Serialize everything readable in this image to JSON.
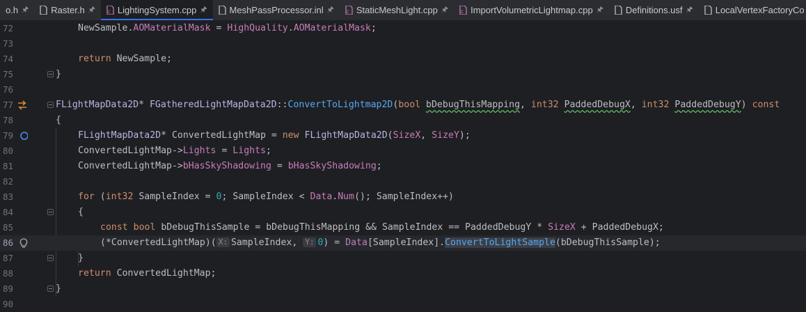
{
  "tabs": [
    {
      "name": "o.h",
      "icon": "header-file-icon",
      "active": false
    },
    {
      "name": "Raster.h",
      "icon": "header-file-icon",
      "active": false
    },
    {
      "name": "LightingSystem.cpp",
      "icon": "cpp-file-icon",
      "active": true
    },
    {
      "name": "MeshPassProcessor.inl",
      "icon": "header-file-icon",
      "active": false
    },
    {
      "name": "StaticMeshLight.cpp",
      "icon": "cpp-file-icon",
      "active": false
    },
    {
      "name": "ImportVolumetricLightmap.cpp",
      "icon": "cpp-file-icon",
      "active": false
    },
    {
      "name": "Definitions.usf",
      "icon": "shader-file-icon",
      "active": false
    },
    {
      "name": "LocalVertexFactoryCo",
      "icon": "shader-file-icon",
      "active": false
    }
  ],
  "pin_glyph": "🖈",
  "line_numbers": [
    "72",
    "73",
    "74",
    "75",
    "76",
    "77",
    "78",
    "79",
    "80",
    "81",
    "82",
    "83",
    "84",
    "85",
    "86",
    "87",
    "88",
    "89",
    "90"
  ],
  "current_line": "86",
  "gutter_icons": {
    "77": "override-arrows-icon",
    "79": "breakpoint-circle-icon",
    "86": "lightbulb-icon"
  },
  "fold_markers": [
    "74",
    "77",
    "84",
    "87",
    "89"
  ],
  "colors": {
    "background": "#1e1f22",
    "keyword": "#cf8e6d",
    "type": "#b5b6e3",
    "function": "#56a8f5",
    "field": "#c77dbb",
    "number": "#2aacb8",
    "accent": "#3574f0"
  },
  "code": {
    "l72": {
      "a": "NewSample.",
      "b": "AOMaterialMask",
      "c": " = ",
      "d": "HighQuality",
      "e": ".",
      "f": "AOMaterialMask",
      "g": ";"
    },
    "l74": {
      "a": "return",
      "b": " NewSample;"
    },
    "l75": {
      "a": "}"
    },
    "l77": {
      "a": "FLightMapData2D",
      "b": "* ",
      "c": "FGatheredLightMapData2D",
      "d": "::",
      "e": "ConvertToLightmap2D",
      "f": "(",
      "g": "bool",
      "h": " ",
      "i": "bDebugThisMapping",
      "j": ", ",
      "k": "int32",
      "l": " ",
      "m": "PaddedDebugX",
      "n": ", ",
      "o": "int32",
      "p": " ",
      "q": "PaddedDebugY",
      "r": ") ",
      "s": "const"
    },
    "l78": {
      "a": "{"
    },
    "l79": {
      "a": "FLightMapData2D",
      "b": "* ConvertedLightMap = ",
      "c": "new",
      "d": " ",
      "e": "FLightMapData2D",
      "f": "(",
      "g": "SizeX",
      "h": ", ",
      "i": "SizeY",
      "j": ");"
    },
    "l80": {
      "a": "ConvertedLightMap->",
      "b": "Lights",
      "c": " = ",
      "d": "Lights",
      "e": ";"
    },
    "l81": {
      "a": "ConvertedLightMap->",
      "b": "bHasSkyShadowing",
      "c": " = ",
      "d": "bHasSkyShadowing",
      "e": ";"
    },
    "l83": {
      "a": "for",
      "b": " (",
      "c": "int32",
      "d": " SampleIndex = ",
      "e": "0",
      "f": "; SampleIndex < ",
      "g": "Data",
      "h": ".",
      "i": "Num",
      "j": "(); SampleIndex++)"
    },
    "l84": {
      "a": "{"
    },
    "l85": {
      "a": "const",
      "b": " ",
      "c": "bool",
      "d": " bDebugThisSample = bDebugThisMapping && SampleIndex == PaddedDebugY * ",
      "e": "SizeX",
      "f": " + PaddedDebugX;"
    },
    "l86": {
      "a": "(*ConvertedLightMap)(",
      "hx": "X:",
      "b": "SampleIndex, ",
      "hy": "Y:",
      "c": "0",
      "d": ") = ",
      "e": "Data",
      "f": "[SampleIndex].",
      "g": "ConvertToLightSample",
      "h": "(bDebugThisSample);"
    },
    "l87": {
      "a": "}"
    },
    "l88": {
      "a": "return",
      "b": " ConvertedLightMap;"
    },
    "l89": {
      "a": "}"
    }
  }
}
